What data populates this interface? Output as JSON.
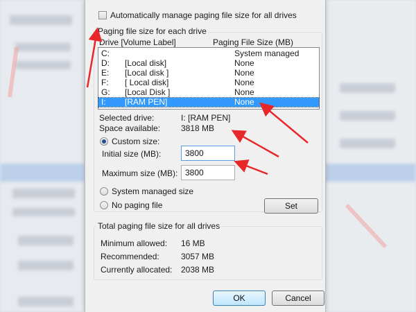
{
  "auto_manage": {
    "label": "Automatically manage paging file size for all drives",
    "checked": false
  },
  "drives_group": {
    "title": "Paging file size for each drive",
    "col_drive": "Drive  [Volume Label]",
    "col_size": "Paging File Size (MB)",
    "rows": [
      {
        "drive": "C:",
        "label": "",
        "size": "System managed",
        "selected": false
      },
      {
        "drive": "D:",
        "label": "[Local disk]",
        "size": "None",
        "selected": false
      },
      {
        "drive": "E:",
        "label": "[Local disk ]",
        "size": "None",
        "selected": false
      },
      {
        "drive": "F:",
        "label": "[ Local disk]",
        "size": "None",
        "selected": false
      },
      {
        "drive": "G:",
        "label": "[Local Disk ]",
        "size": "None",
        "selected": false
      },
      {
        "drive": "I:",
        "label": "[RAM PEN]",
        "size": "None",
        "selected": true
      }
    ]
  },
  "details": {
    "selected_drive_label": "Selected drive:",
    "selected_drive_value": "I:  [RAM PEN]",
    "space_label": "Space available:",
    "space_value": "3818 MB"
  },
  "custom": {
    "radio_label": "Custom size:",
    "initial_label": "Initial size (MB):",
    "initial_value": "3800",
    "max_label": "Maximum size (MB):",
    "max_value": "3800"
  },
  "system_managed_label": "System managed size",
  "no_paging_label": "No paging file",
  "set_label": "Set",
  "total_group": {
    "title": "Total paging file size for all drives",
    "min_label": "Minimum allowed:",
    "min_value": "16 MB",
    "rec_label": "Recommended:",
    "rec_value": "3057 MB",
    "cur_label": "Currently allocated:",
    "cur_value": "2038 MB"
  },
  "ok_label": "OK",
  "cancel_label": "Cancel",
  "annotation_color": "#e8272a"
}
